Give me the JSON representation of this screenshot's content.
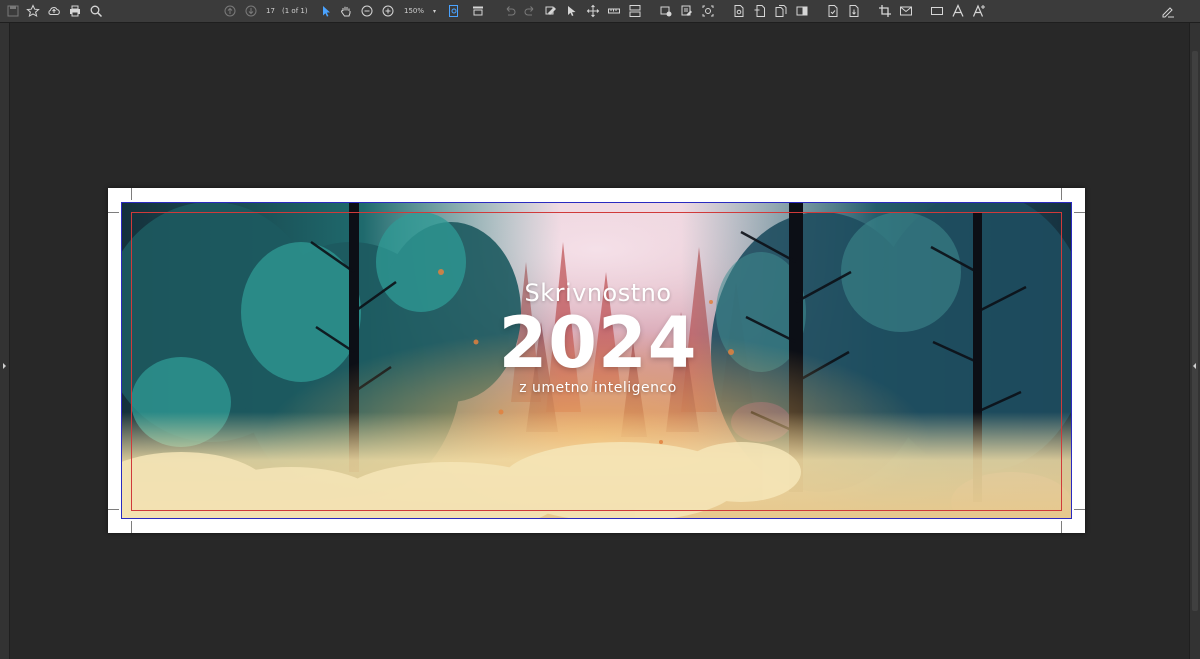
{
  "toolbar": {
    "page_number": "17",
    "page_count": "(1 of 1)",
    "zoom": "150%",
    "icons": [
      "save-icon",
      "bookmark-star-icon",
      "upload-cloud-icon",
      "print-icon",
      "search-icon",
      "previous-page-icon",
      "next-page-icon",
      "select-arrow-icon",
      "hand-tool-icon",
      "zoom-out-icon",
      "zoom-in-icon",
      "fit-page-icon",
      "marquee-zoom-icon",
      "undo-icon",
      "redo-icon",
      "edit-object-icon",
      "select-object-icon",
      "move-icon",
      "measure-icon",
      "layout-icon",
      "output-preview-icon",
      "preflight-icon",
      "fix-hairlines-icon",
      "edit-page-icon",
      "insert-page-icon",
      "extract-page-icon",
      "split-page-icon",
      "page-setup-icon",
      "page-label-icon",
      "crop-icon",
      "mail-icon",
      "rectangle-icon",
      "text-icon",
      "text-edit-icon",
      "sign-icon"
    ]
  },
  "document": {
    "title_small": "Skrivnostno",
    "title_year": "2024",
    "subtitle": "z umetno inteligenco"
  },
  "colors": {
    "app_background": "#282828",
    "toolbar_background": "#3b3b3b",
    "accent": "#4aa3ff",
    "bleed_guide": "#2a2ac0",
    "trim_guide": "#d03a3a"
  }
}
